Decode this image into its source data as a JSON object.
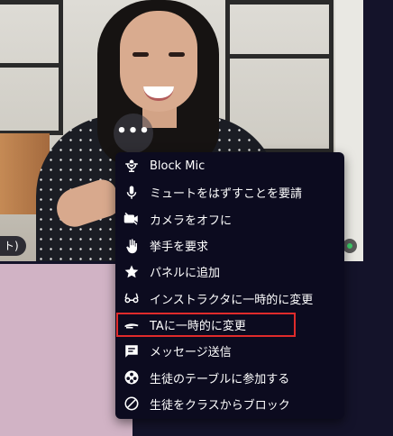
{
  "video": {
    "participant_name_fragment": "ト)",
    "more_button_label": "•••"
  },
  "menu": {
    "items": [
      {
        "label": "Block Mic",
        "icon": "mic-block-icon"
      },
      {
        "label": "ミュートをはずすことを要請",
        "icon": "microphone-icon"
      },
      {
        "label": "カメラをオフに",
        "icon": "camera-off-icon"
      },
      {
        "label": "挙手を要求",
        "icon": "raised-hand-icon"
      },
      {
        "label": "パネルに追加",
        "icon": "star-icon"
      },
      {
        "label": "インストラクタに一時的に変更",
        "icon": "glasses-icon"
      },
      {
        "label": "TAに一時的に変更",
        "icon": "ta-pen-icon",
        "highlighted": true
      },
      {
        "label": "メッセージ送信",
        "icon": "chat-message-icon"
      },
      {
        "label": "生徒のテーブルに参加する",
        "icon": "table-join-icon"
      },
      {
        "label": "生徒をクラスからブロック",
        "icon": "block-circle-icon"
      }
    ]
  },
  "colors": {
    "menu_background": "#0c0b1f",
    "highlight_border": "#e02b2b",
    "status_online": "#3ecf6a"
  }
}
